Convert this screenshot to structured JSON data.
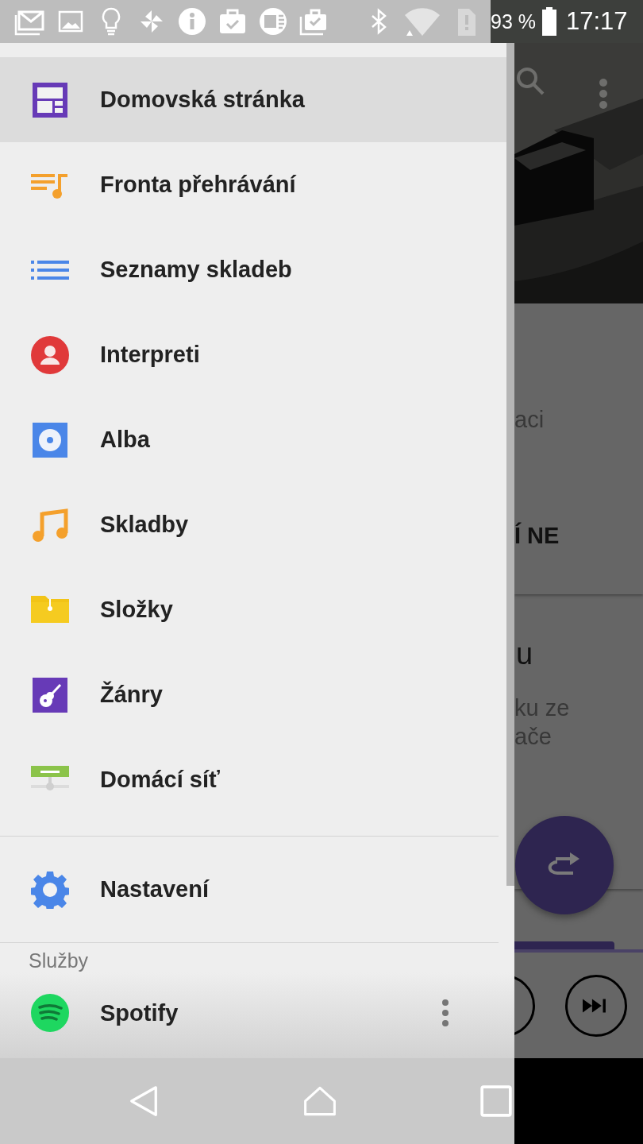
{
  "status_bar": {
    "battery": "93 %",
    "time": "17:17"
  },
  "drawer": {
    "items": [
      {
        "label": "Domovská stránka",
        "kind": "home",
        "selected": true
      },
      {
        "label": "Fronta přehrávání",
        "kind": "queue",
        "selected": false
      },
      {
        "label": "Seznamy skladeb",
        "kind": "playlists",
        "selected": false
      },
      {
        "label": "Interpreti",
        "kind": "artists",
        "selected": false
      },
      {
        "label": "Alba",
        "kind": "albums",
        "selected": false
      },
      {
        "label": "Skladby",
        "kind": "songs",
        "selected": false
      },
      {
        "label": "Složky",
        "kind": "folders",
        "selected": false
      },
      {
        "label": "Žánry",
        "kind": "genres",
        "selected": false
      },
      {
        "label": "Domácí síť",
        "kind": "network",
        "selected": false
      }
    ],
    "settings": {
      "label": "Nastavení",
      "kind": "settings"
    },
    "section_title": "Služby",
    "services": [
      {
        "label": "Spotify",
        "kind": "spotify"
      }
    ]
  },
  "background": {
    "cards": [
      {
        "lines": [
          {
            "text": "aci",
            "kind": "body"
          },
          {
            "text": "Í NE",
            "kind": "action"
          }
        ]
      },
      {
        "lines": [
          {
            "text": "u",
            "kind": "title"
          },
          {
            "text": "ku ze\nače",
            "kind": "body"
          }
        ]
      }
    ]
  }
}
